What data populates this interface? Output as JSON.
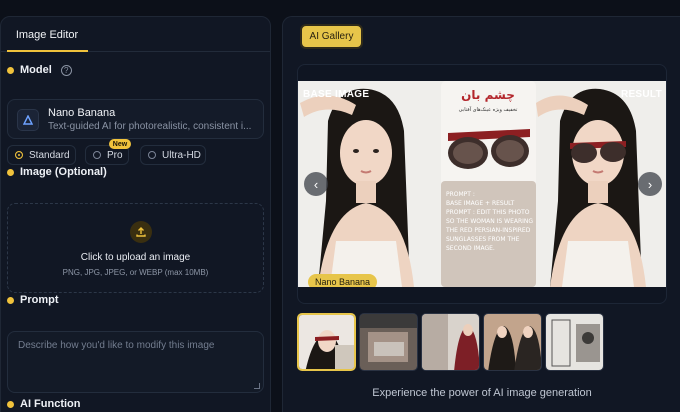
{
  "editor": {
    "tab_label": "Image Editor",
    "model": {
      "section_label": "Model",
      "help_icon": "?",
      "name": "Nano Banana",
      "description": "Text-guided AI for photorealistic, consistent i...",
      "quality_options": [
        {
          "label": "Standard",
          "selected": true
        },
        {
          "label": "Pro",
          "selected": false,
          "badge": "New"
        },
        {
          "label": "Ultra-HD",
          "selected": false
        }
      ]
    },
    "image": {
      "section_label": "Image (Optional)",
      "upload_title": "Click to upload an image",
      "upload_hint": "PNG, JPG, JPEG, or WEBP (max 10MB)"
    },
    "prompt": {
      "section_label": "Prompt",
      "placeholder": "Describe how you'd like to modify this image"
    },
    "ai_function": {
      "section_label": "AI Function"
    }
  },
  "gallery": {
    "button_label": "AI Gallery",
    "hero": {
      "base_label": "BASE IMAGE",
      "result_label": "RESULT",
      "ad_title": "چشم بان",
      "ad_subtitle": "تخفیف ویژه عینک‌های آفتابی",
      "prompt_text": "PROMPT :\nBASE IMAGE + RESULT\nPROMPT : EDIT THIS PHOTO SO THE WOMAN IS WEARING THE RED PERSIAN-INSPIRED SUNGLASSES FROM THE SECOND IMAGE.",
      "model_tag": "Nano Banana",
      "prev_icon": "‹",
      "next_icon": "›"
    },
    "thumbnail_count": 5,
    "tagline": "Experience the power of AI image generation"
  },
  "colors": {
    "accent": "#f0c23c",
    "background": "#0c1019",
    "panel": "#111724"
  }
}
